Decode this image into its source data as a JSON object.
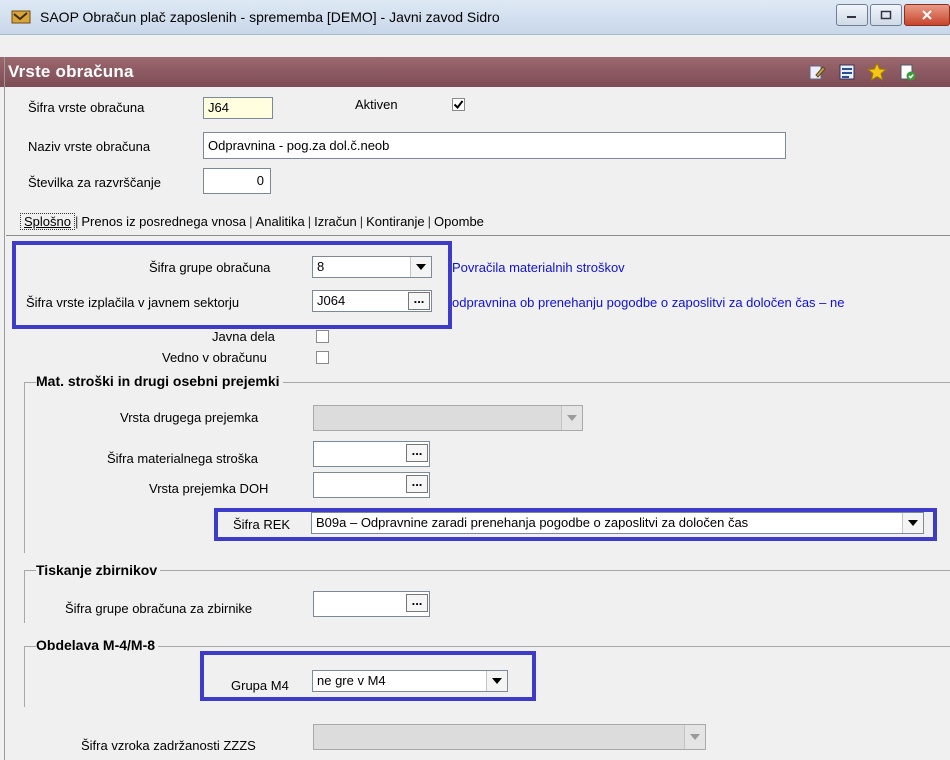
{
  "window": {
    "title": "SAOP Obračun plač zaposlenih - sprememba [DEMO] - Javni zavod Sidro",
    "controls": [
      "minimize",
      "maximize",
      "close"
    ]
  },
  "header": {
    "title": "Vrste obračuna",
    "icons": [
      "edit-icon",
      "list-icon",
      "star-icon",
      "document-check-icon"
    ]
  },
  "form": {
    "sifra_label": "Šifra vrste obračuna",
    "sifra_value": "J64",
    "aktiven_label": "Aktiven",
    "aktiven_checked": true,
    "naziv_label": "Naziv vrste obračuna",
    "naziv_value": "Odpravnina - pog.za dol.č.neob",
    "stevilka_label": "Številka  za razvrščanje",
    "stevilka_value": "0"
  },
  "tabs": [
    "Splošno",
    "Prenos iz posrednega vnosa",
    "Analitika",
    "Izračun",
    "Kontiranje",
    "Opombe"
  ],
  "splosno": {
    "skupina_label": "Šifra grupe obračuna",
    "skupina_value": "8",
    "skupina_desc": "Povračila materialnih stroškov",
    "izplacilo_label": "Šifra vrste izplačila v javnem sektorju",
    "izplacilo_value": "J064",
    "izplacilo_desc": "odpravnina ob prenehanju pogodbe o zaposlitvi za določen čas – ne",
    "javna_dela_label": "Javna dela",
    "vedno_label": "Vedno v obračunu"
  },
  "mat_stroski": {
    "title": "Mat. stroški in drugi osebni prejemki",
    "vrsta_drugega_label": "Vrsta drugega prejemka",
    "sifra_materialnega_label": "Šifra materialnega stroška",
    "vrsta_doh_label": "Vrsta prejemka DOH",
    "rek_label": "Šifra REK",
    "rek_value": "B09a – Odpravnine zaradi prenehanja pogodbe o zaposlitvi za določen čas"
  },
  "tiskanje": {
    "title": "Tiskanje zbirnikov",
    "zbirnike_label": "Šifra grupe obračuna za zbirnike"
  },
  "obdelava": {
    "title": "Obdelava M-4/M-8",
    "grupa_label": "Grupa M4",
    "grupa_value": "ne gre v M4"
  },
  "zzzs": {
    "label": "Šifra vzroka zadržanosti ZZZS"
  },
  "colors": {
    "highlight": "#3d3cc8",
    "link": "#1010d8",
    "header": "#8a5a63"
  }
}
